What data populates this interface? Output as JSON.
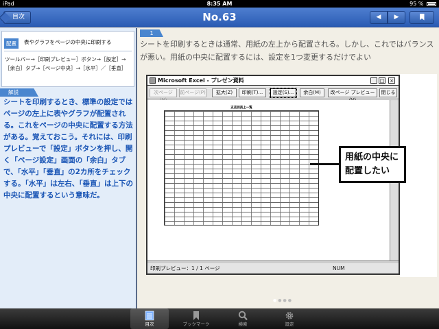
{
  "status_bar": {
    "device": "iPad",
    "time": "8:35 AM",
    "battery": "95 %"
  },
  "nav": {
    "toc_button": "目次",
    "title": "No.63",
    "prev_glyph": "◀",
    "next_glyph": "▶"
  },
  "left": {
    "topic_tag": "配置",
    "topic_title": "表やグラフをページの中央に印刷する",
    "topic_steps": "ツールバー→［印刷プレビュー］ボタン→［設定］→［余白］タブ→［ページ中央］→［水平］／［垂直］",
    "kaisetsu_label": "解説",
    "body": "シートを印刷するとき、標準の設定ではページの左上に表やグラフが配置される。これをページの中央に配置する方法がある。覚えておこう。それには、印刷プレビューで「設定」ボタンを押し、開く「ページ設定」画面の「余白」タブで、「水平」「垂直」の2カ所をチェックする。「水平」は左右、「垂直」は上下の中央に配置するという意味だ。"
  },
  "main": {
    "step_number": "1",
    "text": "シートを印刷するときは通常、用紙の左上から配置される。しかし、これではバランスが悪い。用紙の中央に配置するには、設定を1つ変更するだけでよい",
    "excel": {
      "window_title": "Microsoft Excel - プレゼン資料",
      "toolbar": [
        "次ページ(N)",
        "前ページ(P)",
        "拡大(Z)",
        "印刷(T)...",
        "設定(S)...",
        "余白(M)",
        "改ページ プレビュー(V)",
        "閉じる"
      ],
      "sheet_title": "支店別売上一覧",
      "status_left": "印刷プレビュー：1 / 1 ページ",
      "status_num": "NUM"
    },
    "callout": "用紙の中央に配置したい"
  },
  "tabbar": {
    "tabs": [
      {
        "label": "目次",
        "icon": "toc-icon"
      },
      {
        "label": "ブックマーク",
        "icon": "bookmark-icon"
      },
      {
        "label": "検索",
        "icon": "search-icon"
      },
      {
        "label": "設定",
        "icon": "gear-icon"
      }
    ]
  },
  "colors": {
    "nav_blue": "#2a5bb3",
    "accent_blue": "#4a86cf",
    "body_text_blue": "#1a55b5",
    "left_panel_bg": "#e3edf9",
    "page_bg": "#f2efe6"
  }
}
